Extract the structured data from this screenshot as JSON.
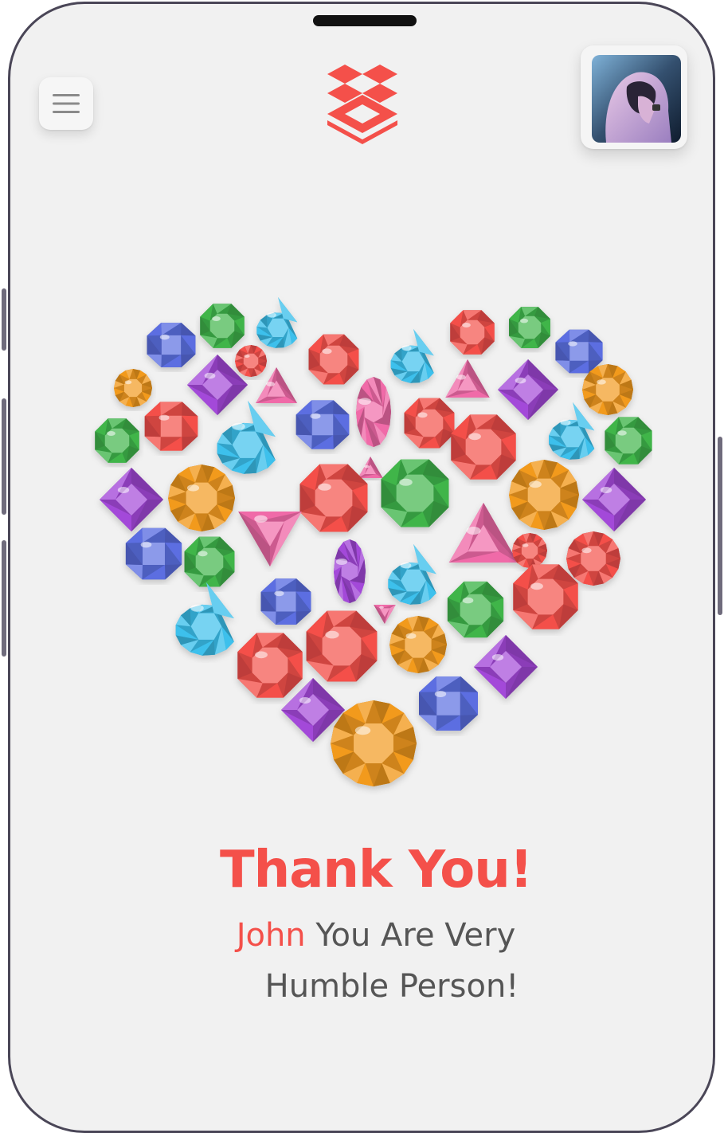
{
  "header": {
    "menu_icon": "hamburger-menu-icon",
    "logo_icon": "stacked-boxes-logo",
    "avatar_icon": "hooded-person-avatar"
  },
  "illustration": {
    "icon": "gem-heart-illustration",
    "gem_colors": [
      "#f4504a",
      "#5b6ee1",
      "#3fb54a",
      "#3cc0ec",
      "#a348d9",
      "#f29a1f",
      "#f06aa8"
    ]
  },
  "message": {
    "title": "Thank You!",
    "name": "John",
    "line1_rest": " You Are Very",
    "line2": "Humble Person!"
  },
  "colors": {
    "accent": "#f4504a",
    "text": "#555555",
    "background": "#f1f1f1",
    "frame": "#4a4657"
  }
}
